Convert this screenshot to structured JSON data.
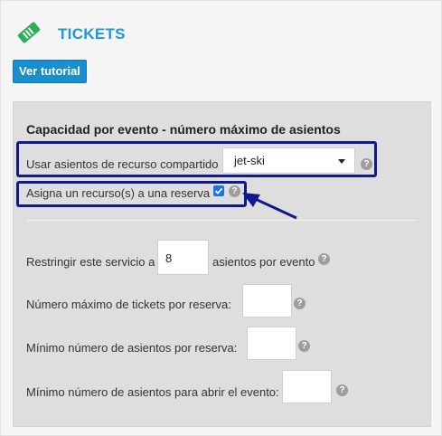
{
  "header": {
    "title": "TICKETS",
    "icon": "ticket-icon",
    "accent_color": "#1a9bd7"
  },
  "tutorial_button": {
    "label": "Ver tutorial"
  },
  "panel": {
    "title": "Capacidad por evento - número máximo de asientos",
    "shared_resource": {
      "label": "Usar asientos de recurso compartido",
      "selected": "jet-ski"
    },
    "assign_resource": {
      "label": "Asigna un recurso(s) a una reserva",
      "checked": true
    },
    "restrict": {
      "label_before": "Restringir este servicio a",
      "value": "8",
      "label_after": "asientos por evento"
    },
    "max_tickets": {
      "label": "Número máximo de tickets por reserva:",
      "value": ""
    },
    "min_seats": {
      "label": "Mínimo número de asientos por reserva:",
      "value": ""
    },
    "min_open": {
      "label": "Mínimo número de asientos para abrir el evento:",
      "value": ""
    },
    "help_glyph": "?"
  },
  "colors": {
    "highlight": "#111a8a",
    "button": "#1a8fd0"
  }
}
